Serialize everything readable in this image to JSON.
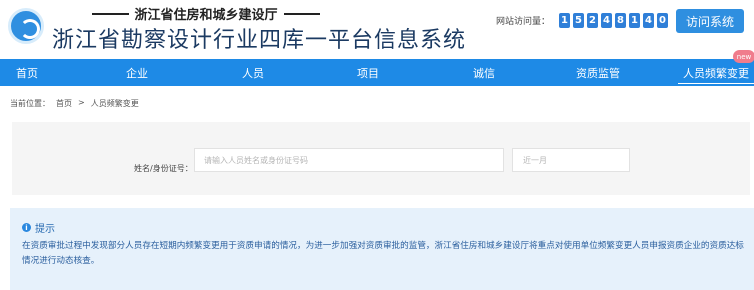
{
  "header": {
    "department": "浙江省住房和城乡建设厅",
    "title": "浙江省勘察设计行业四库一平台信息系统",
    "visit_counter_label": "网站访问量：",
    "visit_counter_digits": [
      "1",
      "5",
      "2",
      "4",
      "8",
      "1",
      "4",
      "0"
    ],
    "visit_button": "访问系统"
  },
  "nav": {
    "items": [
      {
        "label": "首页"
      },
      {
        "label": "企业"
      },
      {
        "label": "人员"
      },
      {
        "label": "项目"
      },
      {
        "label": "诚信"
      },
      {
        "label": "资质监管"
      },
      {
        "label": "人员频繁变更"
      }
    ],
    "active_index": 6,
    "new_badge": "new"
  },
  "breadcrumb": {
    "prefix": "当前位置：",
    "home": "首页",
    "separator": ">",
    "current": "人员频繁变更"
  },
  "search": {
    "label": "姓名/身份证号：",
    "placeholder": "请输入人员姓名或身份证号码",
    "period": "近一月"
  },
  "notice": {
    "title": "提示",
    "body": "在资质审批过程中发现部分人员存在短期内频繁变更用于资质申请的情况，为进一步加强对资质审批的监管，浙江省住房和城乡建设厅将重点对使用单位频繁变更人员申报资质企业的资质达标情况进行动态核查。"
  },
  "colors": {
    "nav_bg": "#1e8ae6",
    "brand_blue": "#2f8fe0",
    "notice_bg": "#e6f1fb",
    "badge": "#f07c8c"
  }
}
